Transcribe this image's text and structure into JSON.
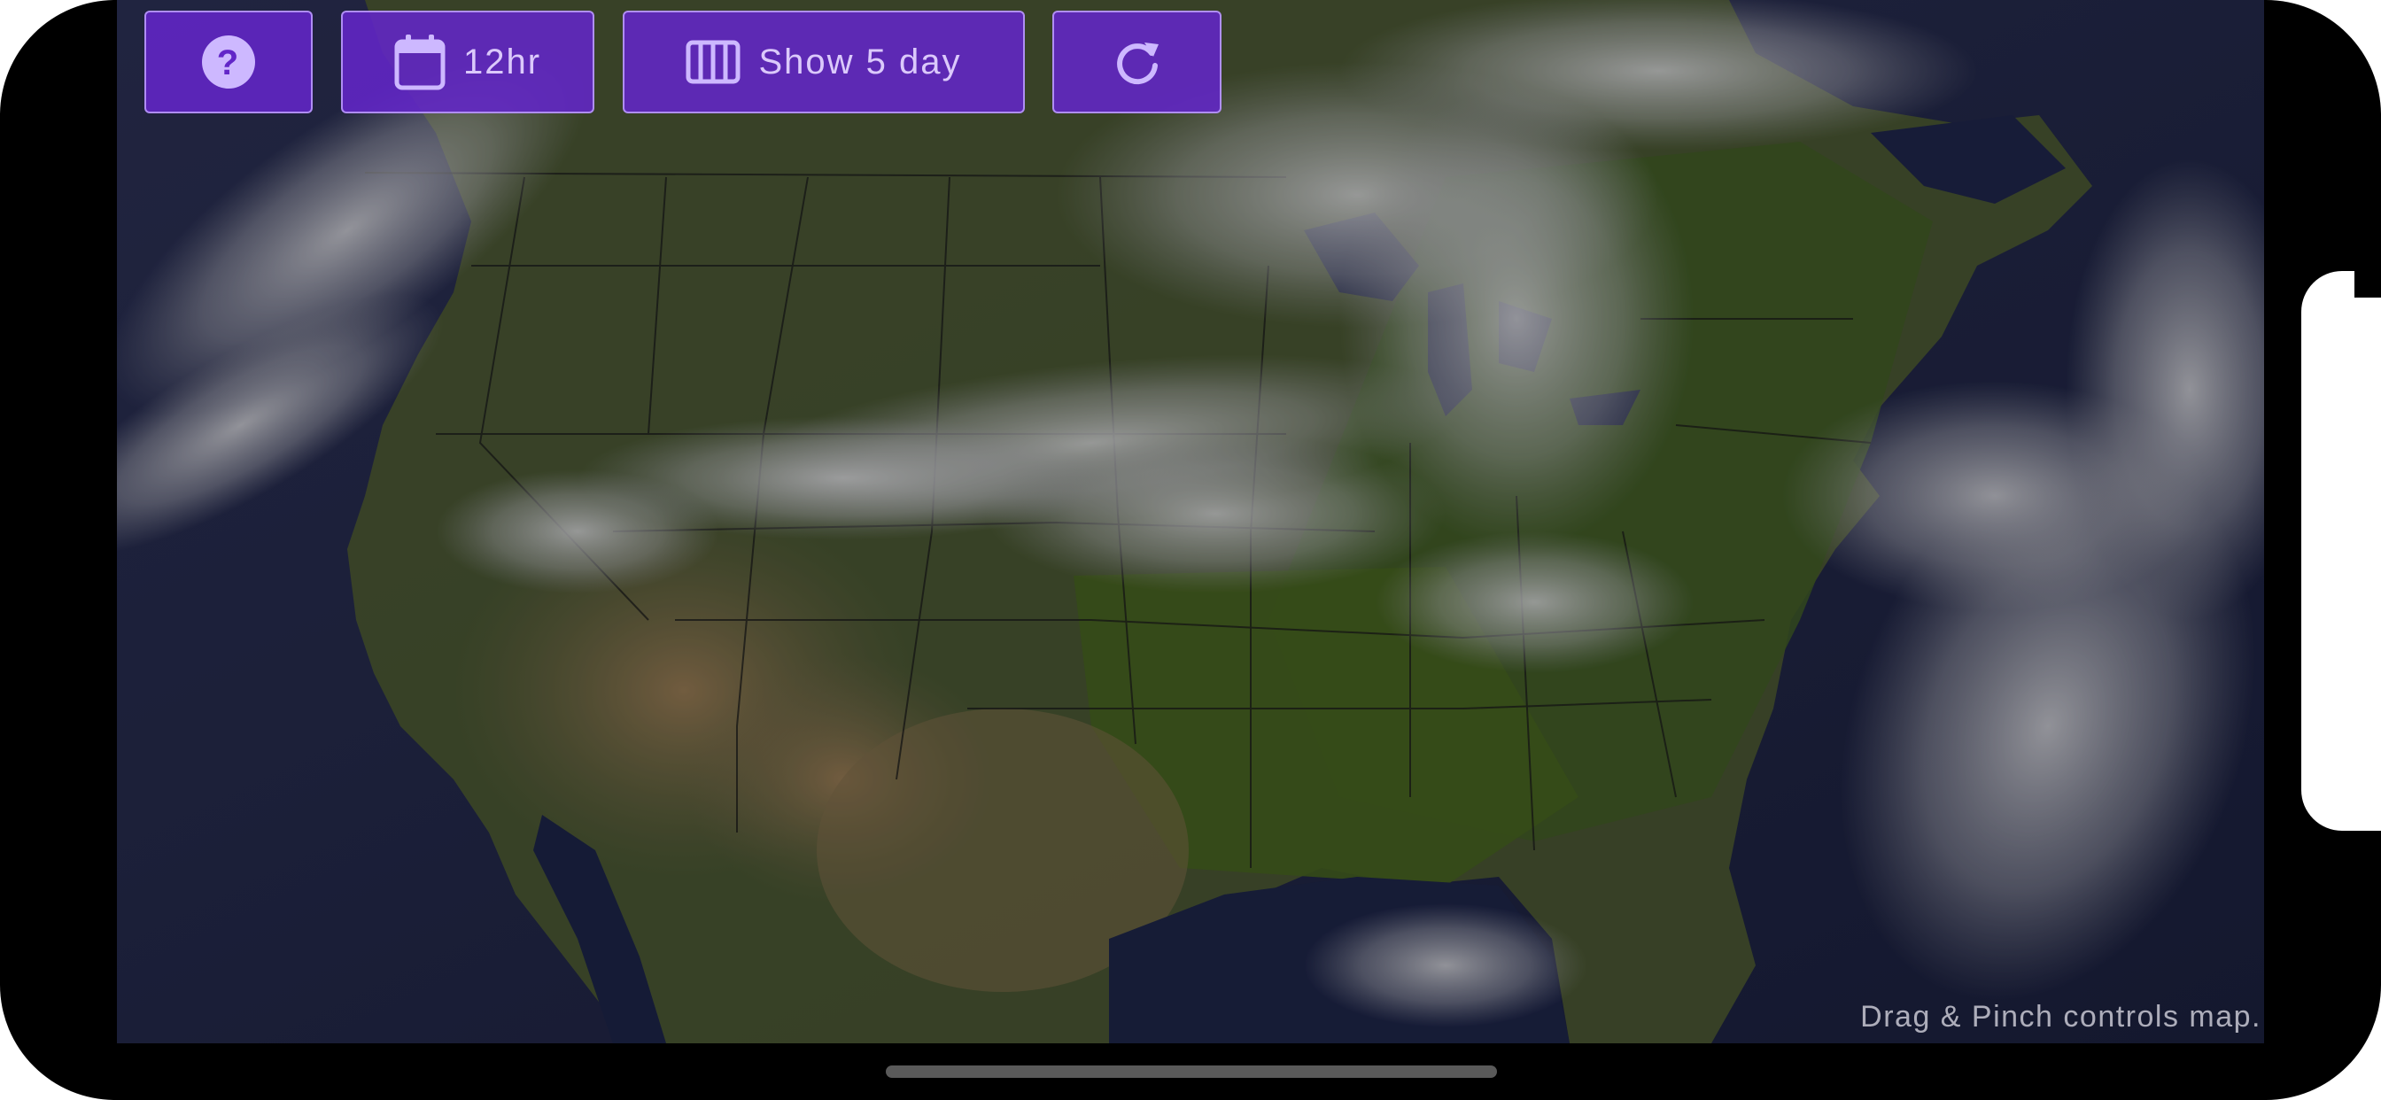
{
  "toolbar": {
    "help_icon": "help-circle-icon",
    "range_icon": "calendar-icon",
    "range_label": "12hr",
    "days_icon": "columns-icon",
    "days_label": "Show 5 day",
    "refresh_icon": "refresh-icon"
  },
  "map": {
    "hint": "Drag & Pinch controls map.",
    "colors": {
      "ocean": "#1c2346",
      "land": "#4b5a32",
      "desert": "#7a6a4c",
      "cloud": "#c8c8cc"
    }
  },
  "theme": {
    "button_bg": "#6226c8",
    "button_border": "#bea0ff",
    "button_text": "#e1d2ff"
  }
}
